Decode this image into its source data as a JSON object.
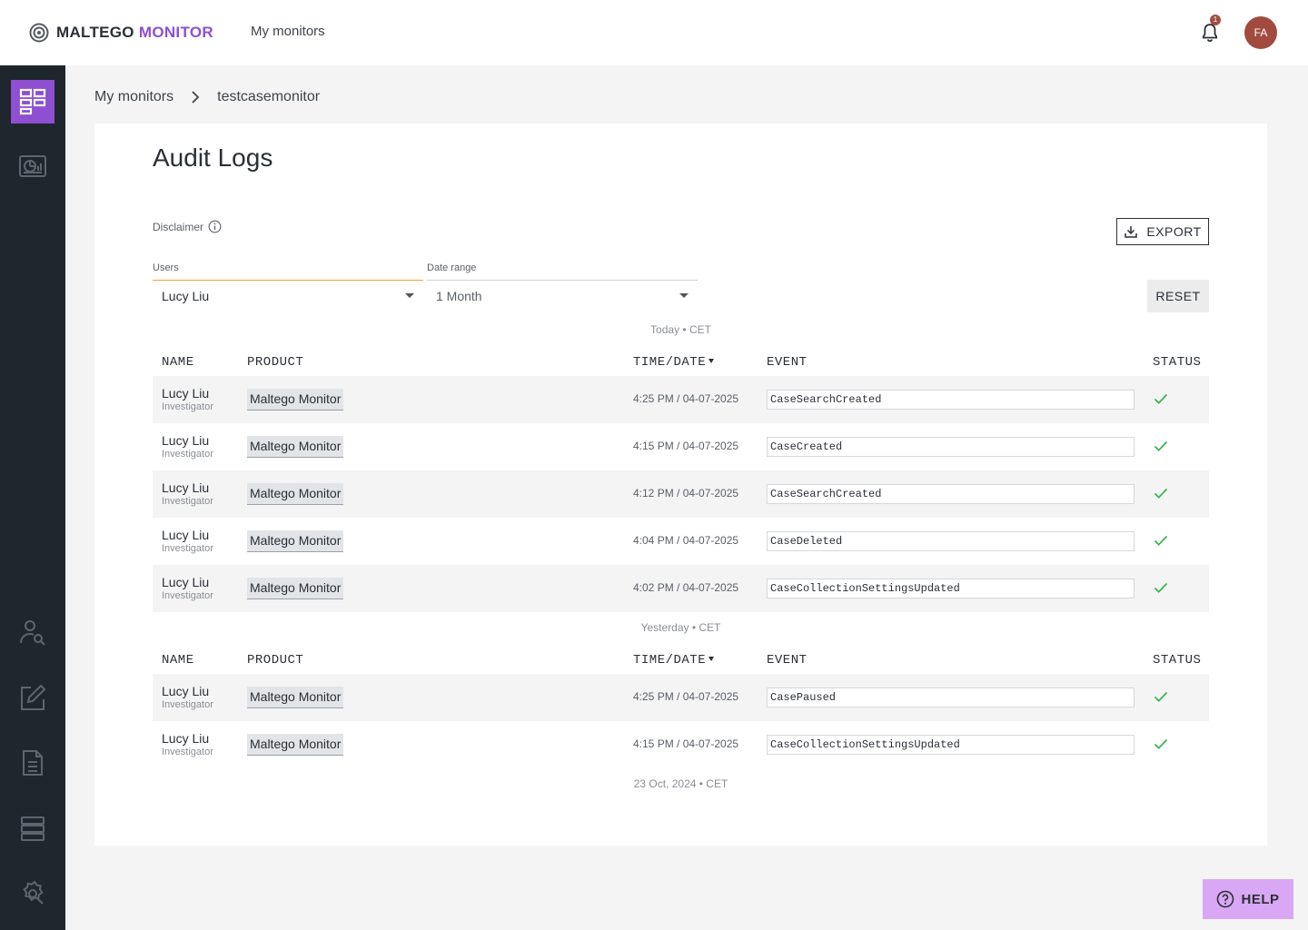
{
  "app": {
    "brand_first": "MALTEGO",
    "brand_second": "MONITOR",
    "nav_link": "My monitors",
    "notification_count": "1",
    "avatar_initials": "FA"
  },
  "sidebar": {
    "items": [
      {
        "icon": "dashboard-grid-icon",
        "active": true
      },
      {
        "icon": "monitor-chart-icon",
        "active": false
      },
      {
        "icon": "user-search-icon",
        "active": false
      },
      {
        "icon": "edit-icon",
        "active": false
      },
      {
        "icon": "document-icon",
        "active": false
      },
      {
        "icon": "server-icon",
        "active": false
      },
      {
        "icon": "settings-gear-icon",
        "active": false
      }
    ]
  },
  "breadcrumb": {
    "root": "My monitors",
    "current": "testcasemonitor"
  },
  "page": {
    "title": "Audit Logs",
    "disclaimer": "Disclaimer",
    "export_label": "EXPORT",
    "reset_label": "RESET"
  },
  "filters": {
    "users_label": "Users",
    "users_value": "Lucy Liu",
    "date_label": "Date range",
    "date_value": "1 Month"
  },
  "columns": {
    "name": "NAME",
    "product": "PRODUCT",
    "time": "TIME/DATE",
    "event": "EVENT",
    "status": "STATUS"
  },
  "groups": [
    {
      "label": "Today • CET",
      "rows": [
        {
          "name": "Lucy Liu",
          "role": "Investigator",
          "product": "Maltego Monitor",
          "time": "4:25 PM / 04-07-2025",
          "event": "CaseSearchCreated"
        },
        {
          "name": "Lucy Liu",
          "role": "Investigator",
          "product": "Maltego Monitor",
          "time": "4:15 PM / 04-07-2025",
          "event": "CaseCreated"
        },
        {
          "name": "Lucy Liu",
          "role": "Investigator",
          "product": "Maltego Monitor",
          "time": "4:12 PM / 04-07-2025",
          "event": "CaseSearchCreated"
        },
        {
          "name": "Lucy Liu",
          "role": "Investigator",
          "product": "Maltego Monitor",
          "time": "4:04 PM / 04-07-2025",
          "event": "CaseDeleted"
        },
        {
          "name": "Lucy Liu",
          "role": "Investigator",
          "product": "Maltego Monitor",
          "time": "4:02 PM / 04-07-2025",
          "event": "CaseCollectionSettingsUpdated"
        }
      ]
    },
    {
      "label": "Yesterday • CET",
      "rows": [
        {
          "name": "Lucy Liu",
          "role": "Investigator",
          "product": "Maltego Monitor",
          "time": "4:25 PM / 04-07-2025",
          "event": "CasePaused"
        },
        {
          "name": "Lucy Liu",
          "role": "Investigator",
          "product": "Maltego Monitor",
          "time": "4:15 PM / 04-07-2025",
          "event": "CaseCollectionSettingsUpdated"
        }
      ]
    },
    {
      "label": "23 Oct, 2024 • CET",
      "rows": []
    }
  ],
  "help": {
    "label": "HELP"
  },
  "colors": {
    "accent": "#8e4fd1",
    "sidebar_bg": "#1f262d",
    "status_ok": "#2fb54a",
    "focus_underline": "#f0a336",
    "help_bg": "#d9a8f4"
  }
}
